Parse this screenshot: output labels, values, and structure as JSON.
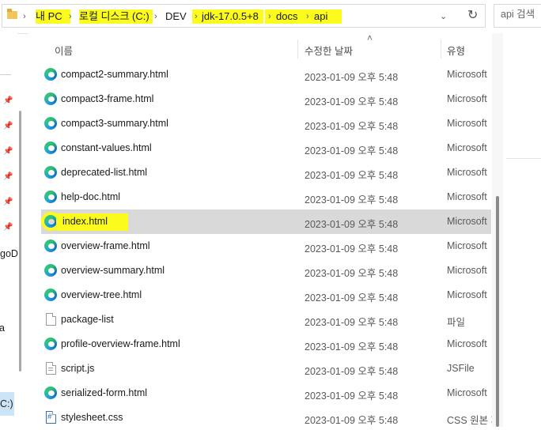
{
  "breadcrumb": {
    "items": [
      "내 PC",
      "로컬 디스크 (C:)",
      "DEV",
      "jdk-17.0.5+8",
      "docs",
      "api"
    ],
    "separator": "›"
  },
  "search": {
    "placeholder": "api 검색"
  },
  "nav": {
    "partial_labels": [
      "goD",
      "a",
      "C:)"
    ]
  },
  "columns": {
    "name": "이름",
    "date": "수정한 날짜",
    "type": "유형"
  },
  "files": [
    {
      "name": "compact2-summary.html",
      "date": "2023-01-09 오후 5:48",
      "type": "Microsoft",
      "icon": "edge-icon"
    },
    {
      "name": "compact3-frame.html",
      "date": "2023-01-09 오후 5:48",
      "type": "Microsoft",
      "icon": "edge-icon"
    },
    {
      "name": "compact3-summary.html",
      "date": "2023-01-09 오후 5:48",
      "type": "Microsoft",
      "icon": "edge-icon"
    },
    {
      "name": "constant-values.html",
      "date": "2023-01-09 오후 5:48",
      "type": "Microsoft",
      "icon": "edge-icon"
    },
    {
      "name": "deprecated-list.html",
      "date": "2023-01-09 오후 5:48",
      "type": "Microsoft",
      "icon": "edge-icon"
    },
    {
      "name": "help-doc.html",
      "date": "2023-01-09 오후 5:48",
      "type": "Microsoft",
      "icon": "edge-icon"
    },
    {
      "name": "index.html",
      "date": "2023-01-09 오후 5:48",
      "type": "Microsoft",
      "icon": "edge-icon"
    },
    {
      "name": "overview-frame.html",
      "date": "2023-01-09 오후 5:48",
      "type": "Microsoft",
      "icon": "edge-icon"
    },
    {
      "name": "overview-summary.html",
      "date": "2023-01-09 오후 5:48",
      "type": "Microsoft",
      "icon": "edge-icon"
    },
    {
      "name": "overview-tree.html",
      "date": "2023-01-09 오후 5:48",
      "type": "Microsoft",
      "icon": "edge-icon"
    },
    {
      "name": "package-list",
      "date": "2023-01-09 오후 5:48",
      "type": "파일",
      "icon": "file-icon"
    },
    {
      "name": "profile-overview-frame.html",
      "date": "2023-01-09 오후 5:48",
      "type": "Microsoft",
      "icon": "edge-icon"
    },
    {
      "name": "script.js",
      "date": "2023-01-09 오후 5:48",
      "type": "JSFile",
      "icon": "js-file-icon"
    },
    {
      "name": "serialized-form.html",
      "date": "2023-01-09 오후 5:48",
      "type": "Microsoft",
      "icon": "edge-icon"
    },
    {
      "name": "stylesheet.css",
      "date": "2023-01-09 오후 5:48",
      "type": "CSS 원본 파일",
      "icon": "css-file-icon"
    }
  ],
  "selected_file": "index.html",
  "colors": {
    "highlight": "#fbfb1e",
    "selection": "#d9d9d9"
  }
}
